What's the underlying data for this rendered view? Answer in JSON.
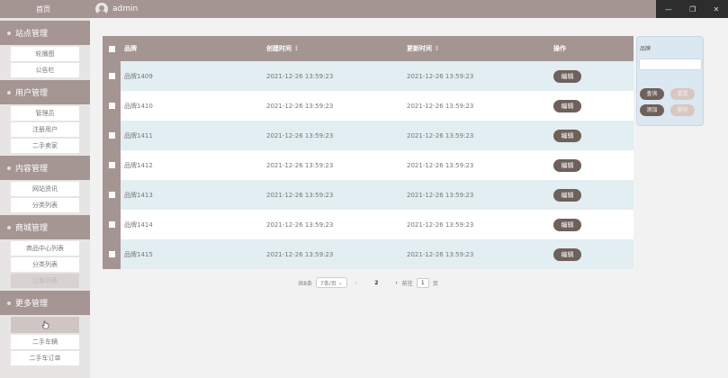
{
  "header": {
    "username": "admin"
  },
  "sidebar": {
    "home": "首页",
    "groups": [
      {
        "label": "站点管理",
        "items": [
          {
            "label": "轮播图"
          },
          {
            "label": "公告栏"
          }
        ]
      },
      {
        "label": "用户管理",
        "items": [
          {
            "label": "管理员"
          },
          {
            "label": "注册用户"
          },
          {
            "label": "二手卖家"
          }
        ]
      },
      {
        "label": "内容管理",
        "items": [
          {
            "label": "网站资讯"
          },
          {
            "label": "分类列表"
          }
        ]
      },
      {
        "label": "商城管理",
        "items": [
          {
            "label": "商品中心列表"
          },
          {
            "label": "分类列表"
          },
          {
            "label": "订单列表"
          }
        ]
      },
      {
        "label": "更多管理",
        "items": [
          {
            "label": ""
          },
          {
            "label": "二手车辆"
          },
          {
            "label": "二手车订单"
          }
        ]
      }
    ]
  },
  "table": {
    "columns": {
      "brand": "品牌",
      "created": "创建时间",
      "updated": "更新时间",
      "actions": "操作"
    },
    "sort_indicator": "↕",
    "rows": [
      {
        "brand": "品牌1409",
        "created": "2021-12-26 13:59:23",
        "updated": "2021-12-26 13:59:23",
        "action": "编辑"
      },
      {
        "brand": "品牌1410",
        "created": "2021-12-26 13:59:23",
        "updated": "2021-12-26 13:59:23",
        "action": "编辑"
      },
      {
        "brand": "品牌1411",
        "created": "2021-12-26 13:59:23",
        "updated": "2021-12-26 13:59:23",
        "action": "编辑"
      },
      {
        "brand": "品牌1412",
        "created": "2021-12-26 13:59:23",
        "updated": "2021-12-26 13:59:23",
        "action": "编辑"
      },
      {
        "brand": "品牌1413",
        "created": "2021-12-26 13:59:23",
        "updated": "2021-12-26 13:59:23",
        "action": "编辑"
      },
      {
        "brand": "品牌1414",
        "created": "2021-12-26 13:59:23",
        "updated": "2021-12-26 13:59:23",
        "action": "编辑"
      },
      {
        "brand": "品牌1415",
        "created": "2021-12-26 13:59:23",
        "updated": "2021-12-26 13:59:23",
        "action": "编辑"
      }
    ]
  },
  "pagination": {
    "total": "共8条",
    "page_size": "7条/页",
    "current_page": "2",
    "goto_label": "前往",
    "goto_value": "1",
    "page_suffix": "页"
  },
  "search_panel": {
    "label": "品牌",
    "input_value": "",
    "query": "查询",
    "reset": "重置",
    "add": "添加",
    "delete": "删除"
  },
  "colors": {
    "primary": "#a49592",
    "button_dark": "#6f605b",
    "row_alt": "#e2eef1"
  }
}
